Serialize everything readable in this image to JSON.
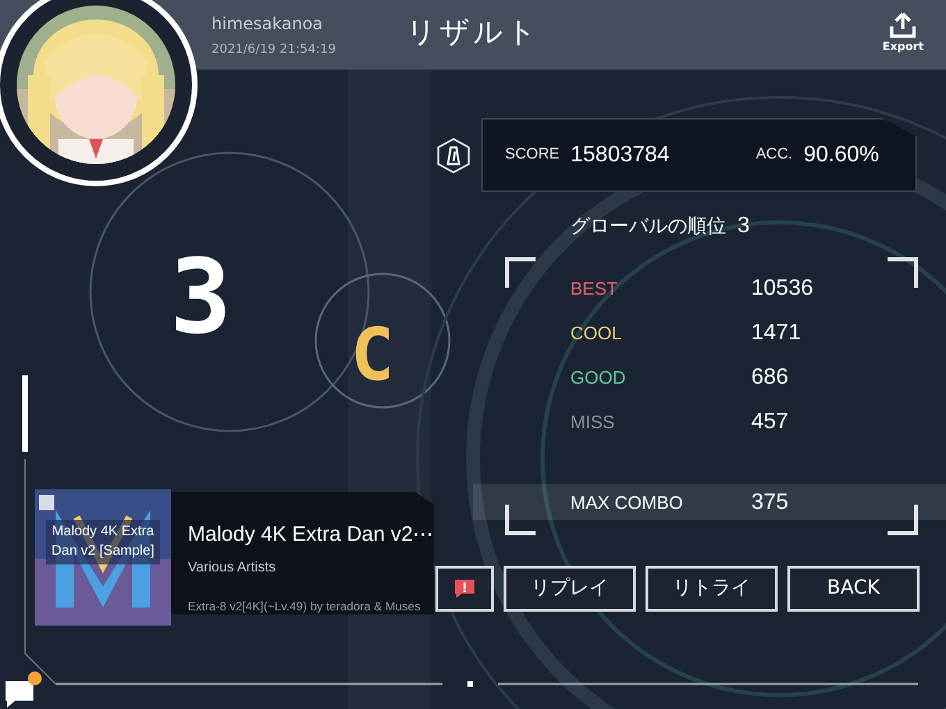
{
  "header": {
    "username": "himesakanoa",
    "datetime": "2021/6/19 21:54:19",
    "title": "リザルト",
    "export_label": "Export"
  },
  "result": {
    "rank_mark": "3",
    "grade": "C"
  },
  "score": {
    "score_label": "SCORE",
    "score_value": "15803784",
    "acc_label": "ACC.",
    "acc_value": "90.60%"
  },
  "global_rank": {
    "label": "グローバルの順位",
    "value": "3"
  },
  "judgements": [
    {
      "label": "BEST",
      "value": "10536",
      "color": "#e0606a"
    },
    {
      "label": "COOL",
      "value": "1471",
      "color": "#e6cf6e"
    },
    {
      "label": "GOOD",
      "value": "686",
      "color": "#5fc9a0"
    },
    {
      "label": "MISS",
      "value": "457",
      "color": "#8a909a"
    }
  ],
  "max_combo": {
    "label": "MAX COMBO",
    "value": "375"
  },
  "song": {
    "cover_text": "Malody 4K Extra Dan v2 [Sample]",
    "title": "Malody 4K Extra Dan v2⋯",
    "artist": "Various Artists",
    "chart": "Extra-8 v2[4K](~Lv.49) by teradora & Muses"
  },
  "buttons": [
    {
      "kind": "icon"
    },
    {
      "kind": "text",
      "label": "リプレイ"
    },
    {
      "kind": "text",
      "label": "リトライ"
    },
    {
      "kind": "text",
      "label": "BACK"
    }
  ]
}
